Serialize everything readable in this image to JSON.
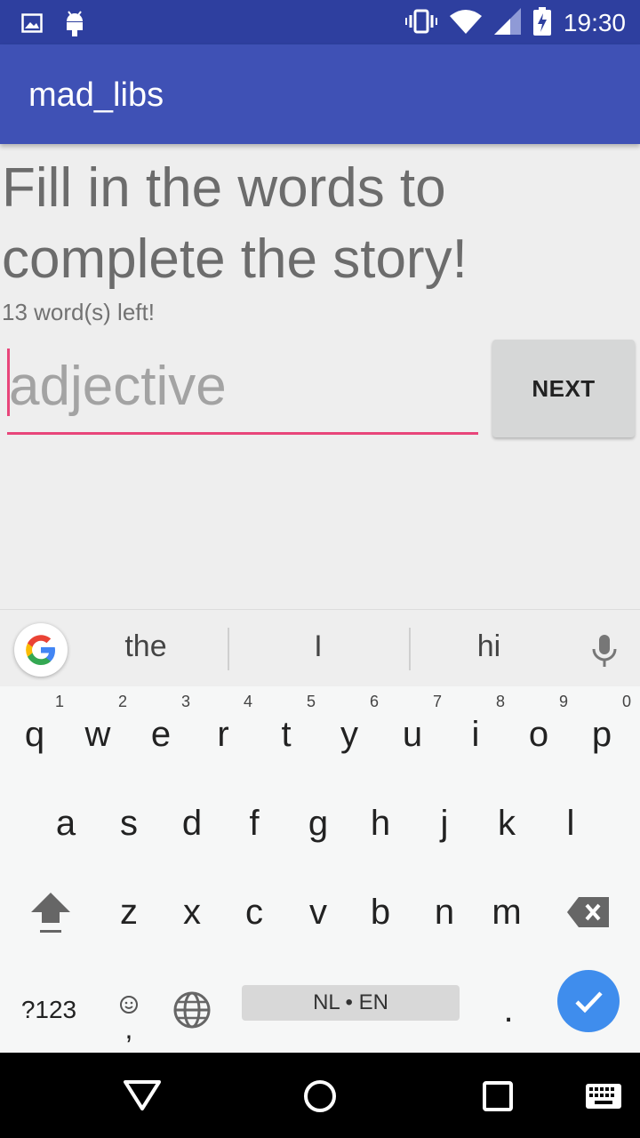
{
  "status_bar": {
    "time": "19:30",
    "icons": [
      "image-icon",
      "android-icon",
      "vibrate-icon",
      "wifi-icon",
      "signal-icon",
      "battery-charging-icon"
    ]
  },
  "app": {
    "title": "mad_libs"
  },
  "content": {
    "heading": "Fill in the words to complete the story!",
    "words_left": "13 word(s) left!",
    "input_placeholder": "adjective",
    "input_value": "",
    "next_label": "NEXT"
  },
  "keyboard": {
    "suggestions": [
      "the",
      "I",
      "hi"
    ],
    "row1": [
      {
        "k": "q",
        "h": "1"
      },
      {
        "k": "w",
        "h": "2"
      },
      {
        "k": "e",
        "h": "3"
      },
      {
        "k": "r",
        "h": "4"
      },
      {
        "k": "t",
        "h": "5"
      },
      {
        "k": "y",
        "h": "6"
      },
      {
        "k": "u",
        "h": "7"
      },
      {
        "k": "i",
        "h": "8"
      },
      {
        "k": "o",
        "h": "9"
      },
      {
        "k": "p",
        "h": "0"
      }
    ],
    "row2": [
      "a",
      "s",
      "d",
      "f",
      "g",
      "h",
      "j",
      "k",
      "l"
    ],
    "row3": [
      "z",
      "x",
      "c",
      "v",
      "b",
      "n",
      "m"
    ],
    "symbols_label": "?123",
    "comma_label": ",",
    "space_label": "NL • EN",
    "period_label": ".",
    "accent_color": "#e8457a",
    "enter_color": "#3f8ded"
  },
  "colors": {
    "status_bar": "#2e3f9f",
    "app_bar": "#3f51b5"
  }
}
